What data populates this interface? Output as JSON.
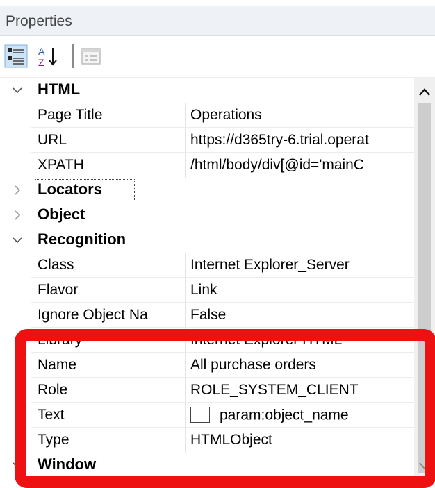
{
  "panel": {
    "title": "Properties"
  },
  "toolbar": {
    "buttons": [
      {
        "icon": "categorized-icon",
        "state": "pressed"
      },
      {
        "icon": "sort-alphabetical-icon",
        "state": "normal"
      },
      {
        "icon": "property-pages-icon",
        "state": "disabled"
      }
    ]
  },
  "grid": {
    "rows": [
      {
        "kind": "category",
        "label": "HTML",
        "expanded": true
      },
      {
        "kind": "property",
        "name": "Page Title",
        "value": "Operations"
      },
      {
        "kind": "property",
        "name": "URL",
        "value": "https://d365try-6.trial.operat"
      },
      {
        "kind": "property",
        "name": "XPATH",
        "value": "/html/body/div[@id='mainC"
      },
      {
        "kind": "category",
        "label": "Locators",
        "expanded": false,
        "focused": true
      },
      {
        "kind": "category",
        "label": "Object",
        "expanded": false
      },
      {
        "kind": "category",
        "label": "Recognition",
        "expanded": true
      },
      {
        "kind": "property",
        "name": "Class",
        "value": "Internet Explorer_Server"
      },
      {
        "kind": "property",
        "name": "Flavor",
        "value": "Link"
      },
      {
        "kind": "property",
        "name": "Ignore Object Na",
        "value": "False"
      },
      {
        "kind": "property",
        "name": "Library",
        "value": "Internet Explorer HTML"
      },
      {
        "kind": "property",
        "name": "Name",
        "value": "All purchase orders"
      },
      {
        "kind": "property",
        "name": "Role",
        "value": "ROLE_SYSTEM_CLIENT"
      },
      {
        "kind": "property",
        "name": "Text",
        "value": "param:object_name",
        "checkbox": true,
        "checked": false
      },
      {
        "kind": "property",
        "name": "Type",
        "value": "HTMLObject"
      },
      {
        "kind": "category",
        "label": "Window",
        "expanded": true
      }
    ]
  },
  "annotation": {
    "color": "#ee1111",
    "shape": "rounded-rectangle",
    "encloses": [
      "Library",
      "Name",
      "Role",
      "Text",
      "Type"
    ]
  }
}
